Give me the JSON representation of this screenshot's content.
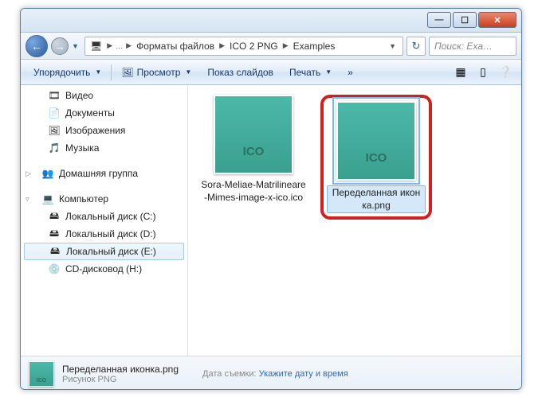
{
  "window_controls": {
    "min": "—",
    "max": "☐",
    "close": "✕"
  },
  "breadcrumb": {
    "items": [
      "Форматы файлов",
      "ICO 2 PNG",
      "Examples"
    ]
  },
  "nav": {
    "refresh": "↻"
  },
  "search": {
    "placeholder": "Поиск: Exa…"
  },
  "toolbar": {
    "organize": "Упорядочить",
    "preview": "Просмотр",
    "slideshow": "Показ слайдов",
    "print": "Печать",
    "more": "»"
  },
  "sidebar": {
    "group1": [
      {
        "icon": "🎞",
        "label": "Видео"
      },
      {
        "icon": "📄",
        "label": "Документы"
      },
      {
        "icon": "🖼",
        "label": "Изображения"
      },
      {
        "icon": "🎵",
        "label": "Музыка"
      }
    ],
    "homegroup": {
      "icon": "👥",
      "label": "Домашняя группа"
    },
    "computer": {
      "icon": "💻",
      "label": "Компьютер"
    },
    "drives": [
      {
        "icon": "🖴",
        "label": "Локальный диск (C:)"
      },
      {
        "icon": "🖴",
        "label": "Локальный диск (D:)"
      },
      {
        "icon": "🖴",
        "label": "Локальный диск (E:)",
        "selected": true
      },
      {
        "icon": "💿",
        "label": "CD-дисковод (H:)"
      }
    ]
  },
  "files": [
    {
      "thumb_text": "ICO",
      "name": "Sora-Meliae-Matrilineare-Mimes-image-x-ico.ico",
      "selected": false
    },
    {
      "thumb_text": "ICO",
      "name": "Переделанная иконка.png",
      "selected": true
    }
  ],
  "details": {
    "thumb_text": "ICO",
    "name": "Переделанная иконка.png",
    "type": "Рисунок PNG",
    "date_label": "Дата съемки:",
    "date_value": "Укажите дату и время"
  }
}
